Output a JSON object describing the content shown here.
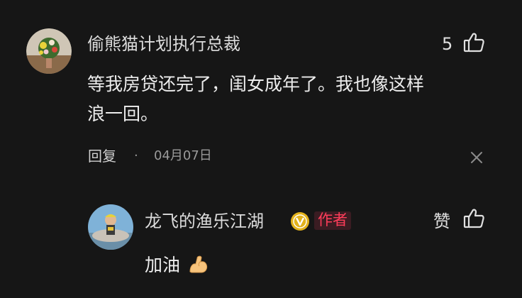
{
  "comments": [
    {
      "username": "偷熊猫计划执行总裁",
      "text_line1": "等我房贷还完了，闺女成年了。我也像这样",
      "text_line2": "浪一回。",
      "like_count": "5",
      "reply_label": "回复",
      "separator": "·",
      "date": "04月07日"
    }
  ],
  "reply": {
    "username": "龙飞的渔乐江湖",
    "author_badge": "作者",
    "text": "加油",
    "emoji": "💪",
    "like_label": "赞"
  },
  "colors": {
    "background": "#161616",
    "author_badge_text": "#ff3d5a",
    "verified_badge": "#e3b21c"
  },
  "icons": [
    "thumbs-up-icon",
    "close-icon",
    "verified-badge-icon",
    "flexed-biceps-icon"
  ]
}
